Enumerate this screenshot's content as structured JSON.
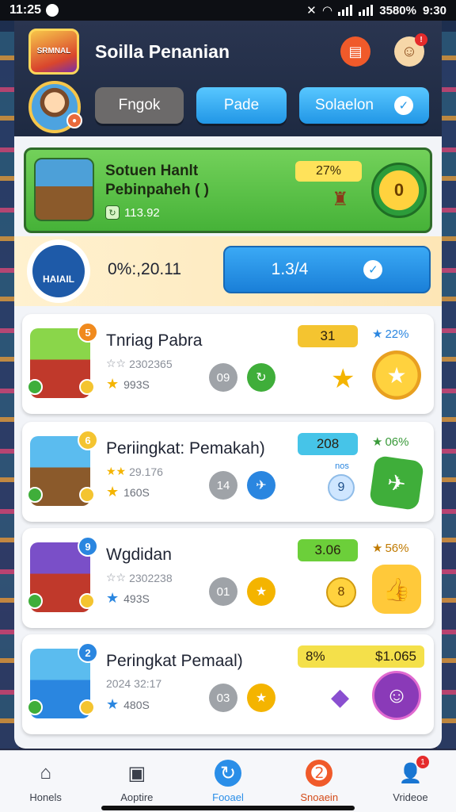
{
  "status_bar": {
    "time": "11:25",
    "battery": "3580%",
    "clock": "9:30"
  },
  "header": {
    "logo_text": "SRMNAL",
    "title": "Soilla Penanian",
    "tabs": [
      {
        "label": "Fngok"
      },
      {
        "label": "Pade"
      },
      {
        "label": "Solaelon"
      }
    ]
  },
  "featured": {
    "title": "Sotuen Hanlt",
    "subtitle": "Pebinpaheh ( )",
    "value": "113.92",
    "percent": "27%",
    "coin": "0"
  },
  "promo": {
    "logo_text": "HAIAIL",
    "text": "0%:,20.11",
    "button_label": "1.3/4"
  },
  "players": [
    {
      "name": "Tnriag Pabra",
      "id": "2302365",
      "points": "993S",
      "rank": "5",
      "grey": "09",
      "score": "31",
      "rate": "22%",
      "accent": "#f4c430"
    },
    {
      "name": "Periingkat: Pemakah)",
      "id": "29.176",
      "points": "160S",
      "rank": "6",
      "grey": "14",
      "score": "208",
      "rate": "06%",
      "accent": "#46c4e8",
      "mid_label": "nos",
      "mid_value": "9"
    },
    {
      "name": "Wgdidan",
      "id": "2302238",
      "points": "493S",
      "rank": "9",
      "grey": "01",
      "score": "3.06",
      "rate": "56%",
      "accent": "#6ccf3a",
      "mid_value": "8"
    },
    {
      "name": "Peringkat Pemaal)",
      "id": "32:17",
      "id_prefix": "2024",
      "points": "480S",
      "rank": "2",
      "grey": "03",
      "score": "8%",
      "score_extra": "$1.065",
      "accent": "#f4e04a"
    }
  ],
  "bottom_nav": [
    {
      "label": "Honels",
      "icon": "home-icon"
    },
    {
      "label": "Aoptire",
      "icon": "gallery-icon"
    },
    {
      "label": "Fooael",
      "icon": "refresh-icon"
    },
    {
      "label": "Snoaein",
      "icon": "fire-icon"
    },
    {
      "label": "Vrideoe",
      "icon": "user-icon",
      "badge": "1"
    }
  ]
}
